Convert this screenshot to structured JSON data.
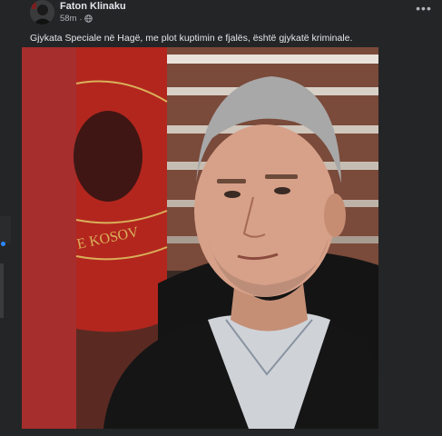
{
  "post": {
    "author": "Faton Klinaku",
    "time": "58m",
    "separator": "·",
    "privacy_icon": "globe-icon",
    "more_icon": "more-options-icon",
    "more_label": "•••",
    "caption": "Gjykata Speciale në Hagë, me plot kuptimin e fjalës, është gjykatë kriminale.",
    "video_flag_text": "E KOSOV"
  },
  "colors": {
    "background": "#18191a",
    "card": "#242526",
    "text_primary": "#e4e6eb",
    "text_secondary": "#b0b3b8",
    "media_frame": "#a62e2d",
    "flag_red": "#b3261e",
    "flag_gold": "#d9b05a"
  }
}
